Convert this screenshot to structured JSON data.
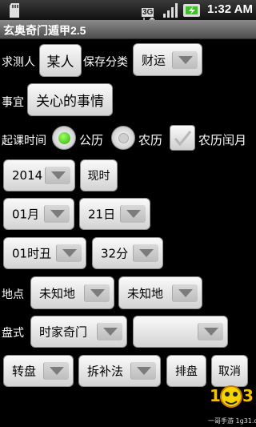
{
  "status_bar": {
    "time": "1:32 AM",
    "network_label": "3G"
  },
  "app": {
    "title": "玄奥奇门遁甲2.5"
  },
  "form": {
    "seeker_label": "求测人",
    "seeker_value": "某人",
    "save_category_label": "保存分类",
    "save_category_value": "财运",
    "matter_label": "事宜",
    "matter_value": "关心的事情",
    "start_time_label": "起课时间",
    "calendar_solar": "公历",
    "calendar_lunar": "农历",
    "calendar_lunar_leap": "农历闰月",
    "selected_calendar": "公历",
    "year_value": "2014",
    "now_button": "现时",
    "month_value": "01月",
    "day_value": "21日",
    "hour_value": "01时丑",
    "minute_value": "32分",
    "location_label": "地点",
    "location_1": "未知地",
    "location_2": "未知地",
    "style_label": "盘式",
    "style_value": "时家奇门",
    "style_sub_value": "",
    "rotation_value": "转盘",
    "method_value": "拆补法",
    "arrange_button": "排盘",
    "cancel_button": "取消"
  },
  "watermark": {
    "text": "一哥手游 1g31.com"
  },
  "colors": {
    "radio_selected": "#3fc400",
    "background": "#000000"
  }
}
